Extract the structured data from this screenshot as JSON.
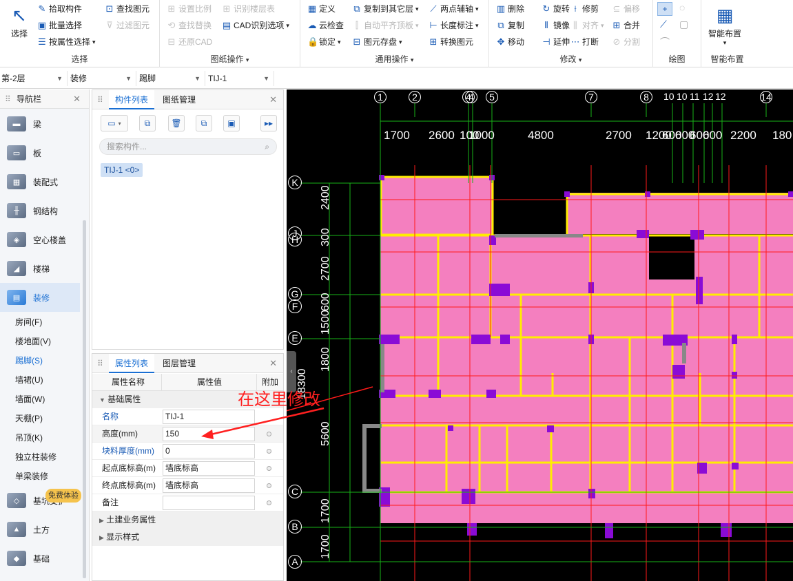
{
  "ribbon": {
    "select": {
      "title": "选择",
      "big": "选择",
      "items": [
        "拾取构件",
        "批量选择",
        "按属性选择",
        "查找图元",
        "过滤图元"
      ]
    },
    "drawing_ops": {
      "title": "图纸操作",
      "items": [
        "设置比例",
        "识别楼层表",
        "查找替换",
        "CAD识别选项",
        "还原CAD"
      ]
    },
    "general_ops": {
      "title": "通用操作",
      "items": [
        "定义",
        "复制到其它层",
        "两点辅轴",
        "云检查",
        "自动平齐顶板",
        "长度标注",
        "锁定",
        "图元存盘",
        "转换图元"
      ]
    },
    "modify": {
      "title": "修改",
      "items": [
        "删除",
        "旋转",
        "修剪",
        "偏移",
        "复制",
        "镜像",
        "对齐",
        "合并",
        "移动",
        "延伸",
        "打断",
        "分割"
      ]
    },
    "draw": {
      "title": "绘图"
    },
    "smart": {
      "title": "智能布置",
      "big": "智能布置"
    }
  },
  "selectors": [
    "第-2层",
    "装修",
    "踢脚",
    "TIJ-1"
  ],
  "nav": {
    "title": "导航栏",
    "items": [
      "梁",
      "板",
      "装配式",
      "钢结构",
      "空心楼盖",
      "楼梯",
      "装修"
    ],
    "sub_items": [
      "房间(F)",
      "楼地面(V)",
      "踢脚(S)",
      "墙裙(U)",
      "墙面(W)",
      "天棚(P)",
      "吊顶(K)",
      "独立柱装修",
      "单梁装修"
    ],
    "active_sub": "踢脚(S)",
    "lower_items": [
      "基坑支护",
      "土方",
      "基础"
    ],
    "ad_badge": "免费体验"
  },
  "component_panel": {
    "tabs": [
      "构件列表",
      "图纸管理"
    ],
    "search_placeholder": "搜索构件...",
    "selected_component": "TIJ-1 <0>"
  },
  "property_panel": {
    "tabs": [
      "属性列表",
      "图层管理"
    ],
    "headers": [
      "属性名称",
      "属性值",
      "附加"
    ],
    "section_basic": "基础属性",
    "rows": [
      {
        "name": "名称",
        "value": "TIJ-1"
      },
      {
        "name": "高度(mm)",
        "value": "150"
      },
      {
        "name": "块料厚度(mm)",
        "value": "0"
      },
      {
        "name": "起点底标高(m)",
        "value": "墙底标高"
      },
      {
        "name": "终点底标高(m)",
        "value": "墙底标高"
      },
      {
        "name": "备注",
        "value": ""
      }
    ],
    "section_civil": "土建业务属性",
    "section_display": "显示样式"
  },
  "annotation": "在这里修改",
  "cad": {
    "axis_top": [
      "1",
      "2",
      "4",
      "4",
      "5",
      "7",
      "8",
      "10",
      "10",
      "11",
      "12",
      "12",
      "14"
    ],
    "dim_top": [
      "1700",
      "2600",
      "100",
      "1000",
      "4800",
      "2700",
      "1200",
      "600",
      "600",
      "600",
      "600",
      "2200",
      "180"
    ],
    "axis_left": [
      "K",
      "J",
      "H",
      "G",
      "F",
      "E",
      "D",
      "C",
      "B",
      "A"
    ],
    "dim_left": [
      "2400",
      "300",
      "2700",
      "600",
      "1500",
      "1800",
      "5600",
      "1700",
      "1700"
    ],
    "total_left": "18300"
  },
  "colors": {
    "accent": "#1a6fd3",
    "cad_bg": "#000000",
    "room_fill": "#f47fbf",
    "wall": "#ffee00",
    "column": "#8a0bd6",
    "annotation": "#ff2020"
  }
}
